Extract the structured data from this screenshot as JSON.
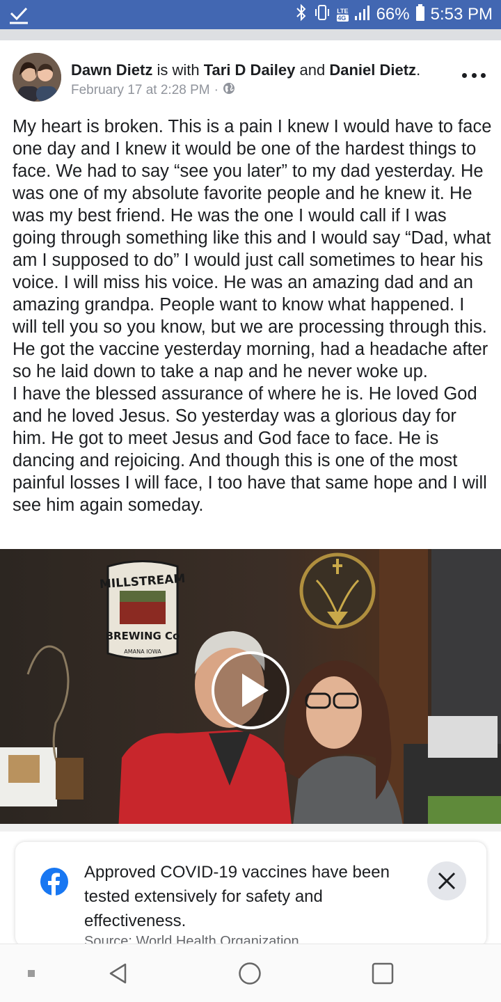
{
  "status_bar": {
    "battery": "66%",
    "time": "5:53 PM",
    "network_badge_top": "4G",
    "network_badge_lte": "LTE",
    "icons": [
      "download-check-icon",
      "bluetooth-icon",
      "vibrate-icon",
      "signal-icon",
      "battery-icon"
    ]
  },
  "post": {
    "author": "Dawn Dietz",
    "is_with_text": "is with",
    "tagged_1": "Tari D Dailey",
    "and_text": "and",
    "tagged_2": "Daniel Dietz",
    "period": ".",
    "date": "February 17 at 2:28 PM",
    "dot": "·",
    "privacy_icon": "globe-icon",
    "paragraph_1": "My heart is broken. This is a pain I knew I would have to face one day and I knew it would be one of the hardest things to face. We had to say “see you later” to my dad yesterday. He was one of my absolute favorite people and he knew it. He was my best friend. He was the one I would call if I was going through something like this and I would say “Dad, what am I supposed to do” I would just call sometimes to hear his voice. I will miss his voice. He was an amazing dad and an amazing grandpa. People want to know what happened. I will tell you so you know, but we are processing through this. He got the vaccine yesterday morning, had a headache after so he laid down to take a nap and he never woke up.",
    "paragraph_2": "I have the blessed assurance of where he is. He loved God and he loved Jesus. So yesterday was a glorious day for him. He got to meet Jesus and God face to face. He is dancing and rejoicing. And though this is one of the most painful losses I will face, I too have that same hope and I will see him again someday."
  },
  "video": {
    "sign_line_1": "MILLSTREAM",
    "sign_line_2": "BREWING Co",
    "sign_line_3": "AMANA IOWA"
  },
  "info_card": {
    "text": "Approved COVID-19 vaccines have been tested extensively for safety and effectiveness.",
    "source": "Source: World Health Organization"
  },
  "colors": {
    "facebook_blue": "#4267b2",
    "fb_logo_blue": "#1877f2",
    "shirt_red": "#c8262c"
  }
}
